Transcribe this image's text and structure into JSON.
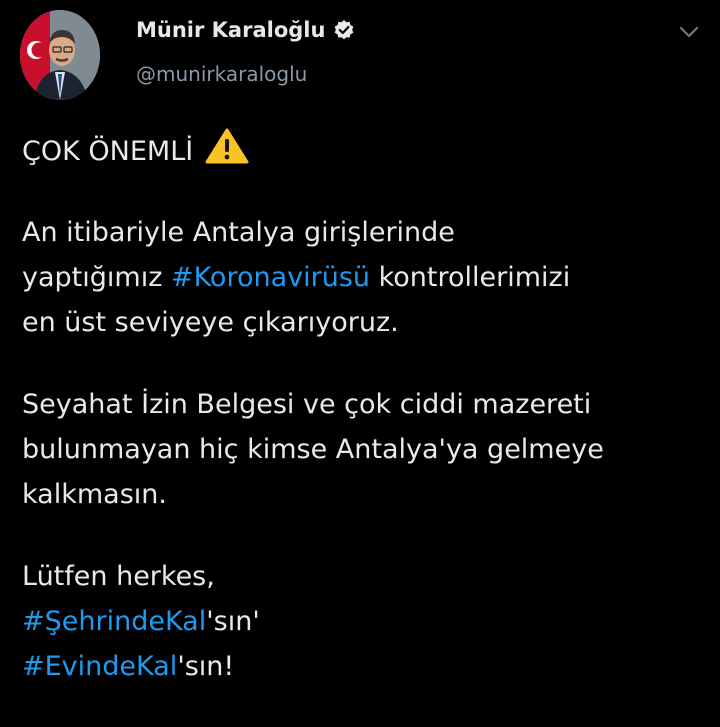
{
  "author": {
    "display_name": "Münir Karaloğlu",
    "handle": "@munirkaraloglu",
    "verified": true,
    "avatar_icon": "profile-photo-avatar"
  },
  "menu_icon": "chevron-down-icon",
  "tweet": {
    "headline": "ÇOK ÖNEMLİ",
    "headline_icon": "warning-icon",
    "p1_l1": "An itibariyle Antalya girişlerinde",
    "p1_l2_pre": "yaptığımız ",
    "p1_l2_tag": "#Koronavirüsü",
    "p1_l2_post": " kontrollerimizi",
    "p1_l3": "en üst seviyeye çıkarıyoruz.",
    "p2_l1": "Seyahat İzin Belgesi ve çok ciddi mazereti",
    "p2_l2": "bulunmayan hiç kimse Antalya'ya gelmeye",
    "p2_l3": "kalkmasın.",
    "p3_l1": "Lütfen herkes,",
    "p3_l2_tag": "#ŞehrindeKal",
    "p3_l2_post": "'sın'",
    "p3_l3_tag": "#EvindeKal",
    "p3_l3_post": "'sın!"
  },
  "colors": {
    "background": "#000000",
    "text": "#e7e9ea",
    "secondary": "#8b98a5",
    "hashtag": "#1d9bf0",
    "warning": "#f7c325"
  }
}
